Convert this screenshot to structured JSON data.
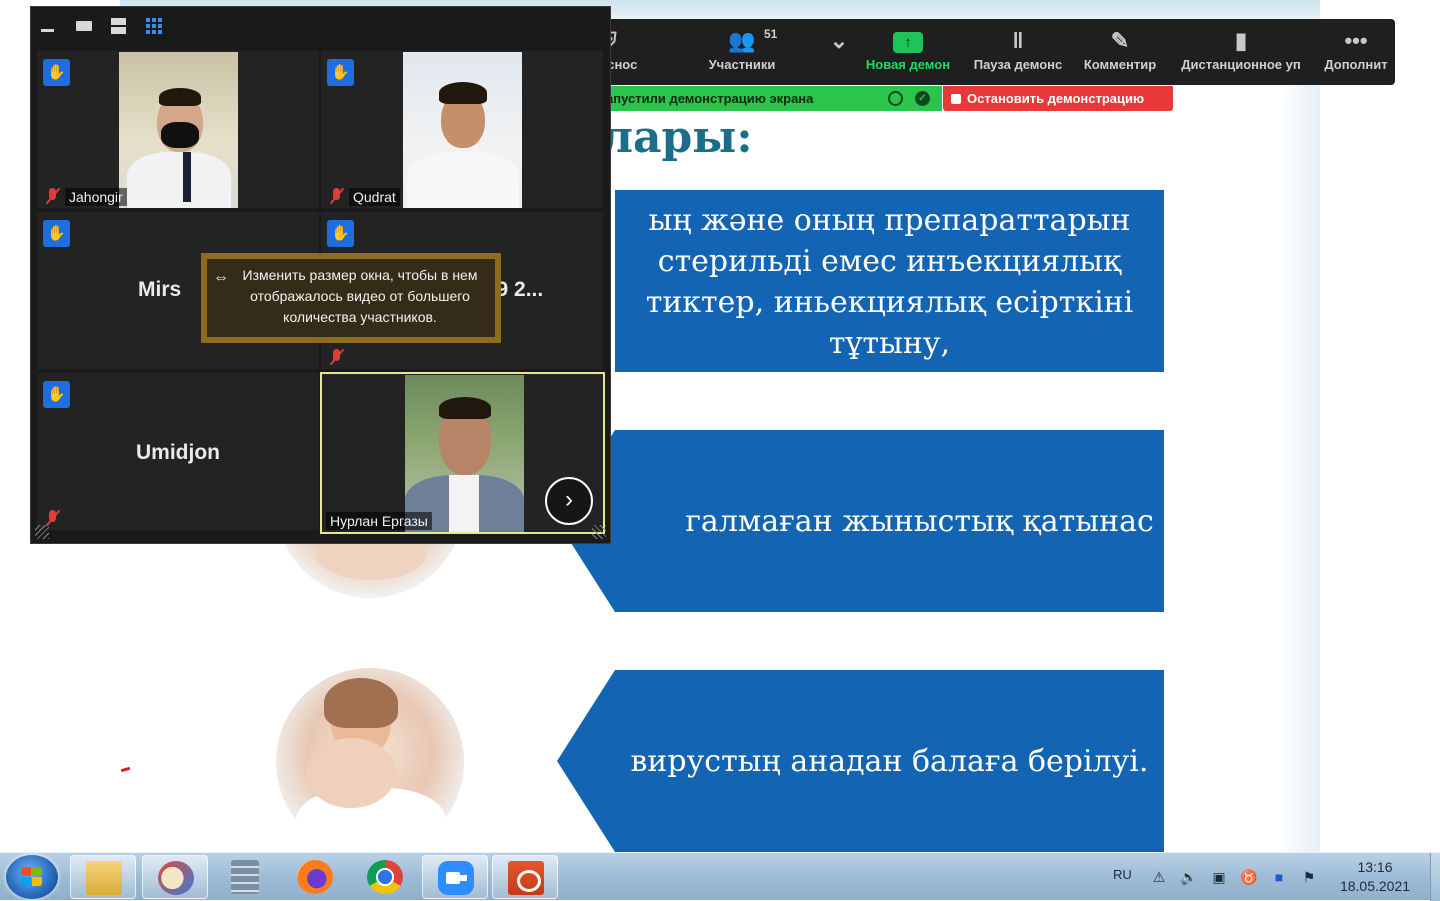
{
  "slide": {
    "title_fragment": "лары:",
    "box1_text": "ың және оның препараттарын стерильді емес инъекциялық тиктер, иньекциялық есірткіні тұтыну,",
    "box2_text": "галмаған жыныстық қатынас",
    "box3_text": "вирустың анадан балаға берілуі."
  },
  "toolbar": {
    "security_label": "аснос",
    "participants_label": "Участники",
    "participants_count": "51",
    "new_share_label": "Новая демон",
    "pause_label": "Пауза демонс",
    "annotate_label": "Комментир",
    "remote_label": "Дистанционное уп",
    "more_label": "Дополнит",
    "icons": {
      "security": "shield-icon",
      "participants": "participants-icon",
      "caret": "chevron-down-icon",
      "new_share": "share-up-arrow-icon",
      "pause": "pause-icon",
      "annotate": "pencil-icon",
      "remote": "mouse-icon",
      "more": "ellipsis-icon"
    }
  },
  "share_status": {
    "text": "апустили демонстрацию экрана",
    "stop_label": "Остановить демонстрацию"
  },
  "gallery": {
    "tiles": [
      {
        "name": "Jahongir",
        "raised_hand": true,
        "muted": true,
        "has_video": true
      },
      {
        "name": "Qudrat",
        "raised_hand": true,
        "muted": true,
        "has_video": true
      },
      {
        "name": "Mirs",
        "name_suffix": "И (э9 2...",
        "raised_hand": true,
        "muted": false,
        "has_video": false
      },
      {
        "name": "",
        "raised_hand": true,
        "muted": true,
        "has_video": false
      },
      {
        "name": "Umidjon",
        "raised_hand": true,
        "muted": true,
        "has_video": false
      },
      {
        "name": "Нурлан Ергазы",
        "raised_hand": false,
        "muted": false,
        "has_video": true,
        "active_speaker": true
      }
    ],
    "tooltip": "Изменить размер окна, чтобы в нем отображалось видео от большего количества участников."
  },
  "taskbar": {
    "apps": [
      "Windows Explorer",
      "Paint",
      "Calculator",
      "Firefox",
      "Chrome",
      "Zoom",
      "PowerPoint"
    ],
    "language": "RU",
    "time": "13:16",
    "date": "18.05.2021"
  },
  "colors": {
    "slide_blue": "#1464b4",
    "slide_title": "#1a6e8a",
    "zoom_green": "#23d962",
    "stop_red": "#e8393a",
    "hand_blue": "#1b6fe0",
    "active_speaker_border": "#e6e88a"
  }
}
